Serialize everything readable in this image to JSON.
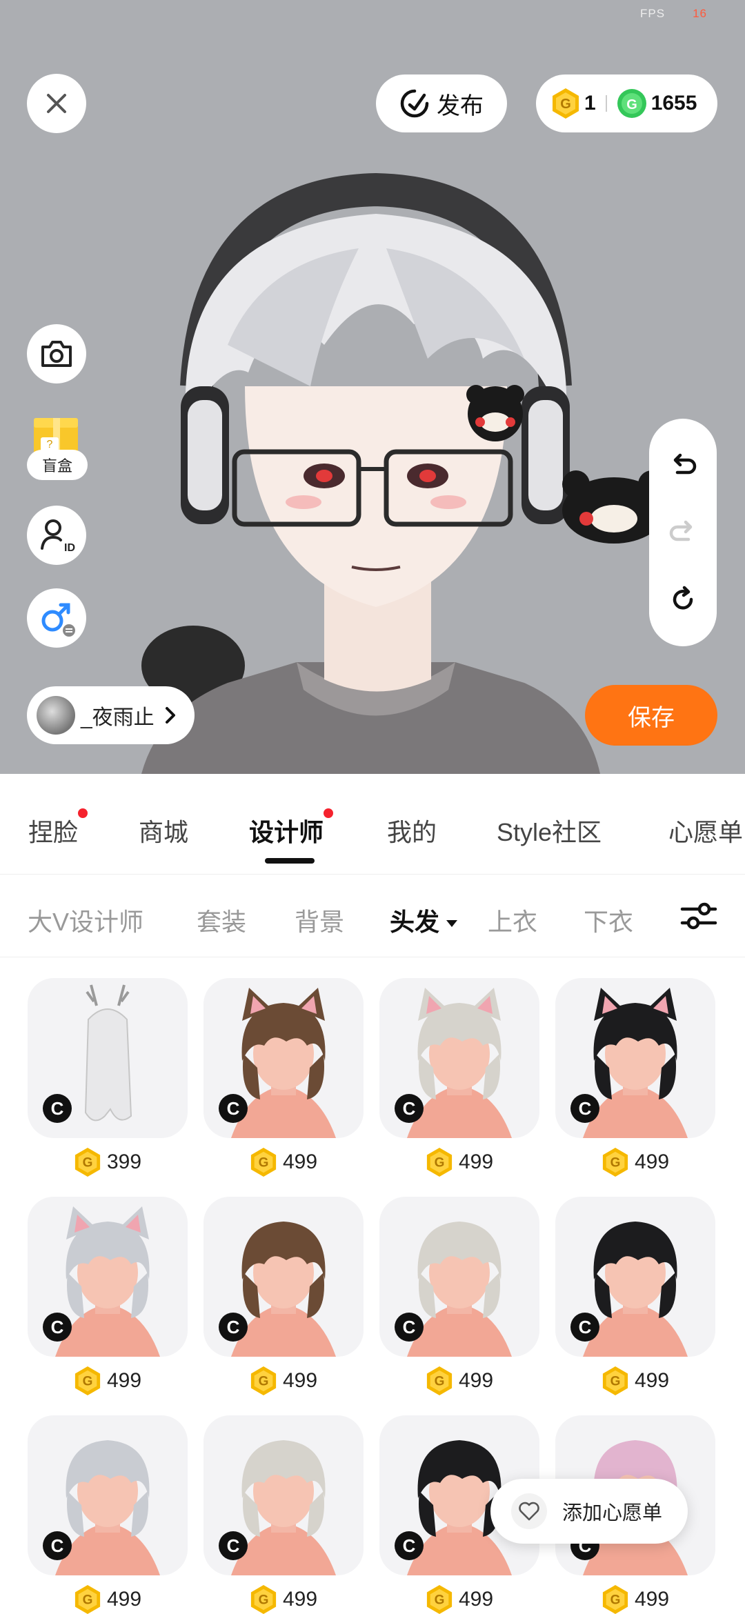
{
  "status": {
    "fps_label": "FPS",
    "fps_value": "16"
  },
  "header": {
    "publish_label": "发布",
    "gold_balance": "1",
    "green_balance": "1655"
  },
  "side": {
    "blindbox_label": "盲盒"
  },
  "user": {
    "name": "_夜雨止"
  },
  "actions": {
    "save_label": "保存"
  },
  "main_tabs": [
    {
      "label": "捏脸",
      "dot": true
    },
    {
      "label": "商城",
      "dot": false
    },
    {
      "label": "设计师",
      "dot": true,
      "active": true
    },
    {
      "label": "我的",
      "dot": false
    },
    {
      "label": "Style社区",
      "dot": false
    },
    {
      "label": "心愿单",
      "dot": false
    }
  ],
  "sub_tabs": [
    {
      "label": "大V设计师"
    },
    {
      "label": "套装"
    },
    {
      "label": "背景"
    },
    {
      "label": "头发",
      "active": true
    },
    {
      "label": "上衣"
    },
    {
      "label": "下衣"
    }
  ],
  "items": [
    {
      "price": "399",
      "hair": "#e8e8ea",
      "style": "long-antler"
    },
    {
      "price": "499",
      "hair": "#6b4b35",
      "style": "cat"
    },
    {
      "price": "499",
      "hair": "#d6d3cc",
      "style": "cat"
    },
    {
      "price": "499",
      "hair": "#1c1c1e",
      "style": "cat"
    },
    {
      "price": "499",
      "hair": "#c9ccd2",
      "style": "cat"
    },
    {
      "price": "499",
      "hair": "#6b4b35",
      "style": "short"
    },
    {
      "price": "499",
      "hair": "#d6d3cc",
      "style": "short"
    },
    {
      "price": "499",
      "hair": "#1c1c1e",
      "style": "short"
    },
    {
      "price": "499",
      "hair": "#c9ccd2",
      "style": "short"
    },
    {
      "price": "499",
      "hair": "#d6d3cc",
      "style": "short"
    },
    {
      "price": "499",
      "hair": "#1c1c1e",
      "style": "short"
    },
    {
      "price": "499",
      "hair": "#e2b4cf",
      "style": "short"
    }
  ],
  "badge_letter": "C",
  "wishlist_label": "添加心愿单",
  "colors": {
    "accent": "#ff7413",
    "gold": "#f5b800",
    "green": "#34c759",
    "notify": "#f5222d"
  }
}
